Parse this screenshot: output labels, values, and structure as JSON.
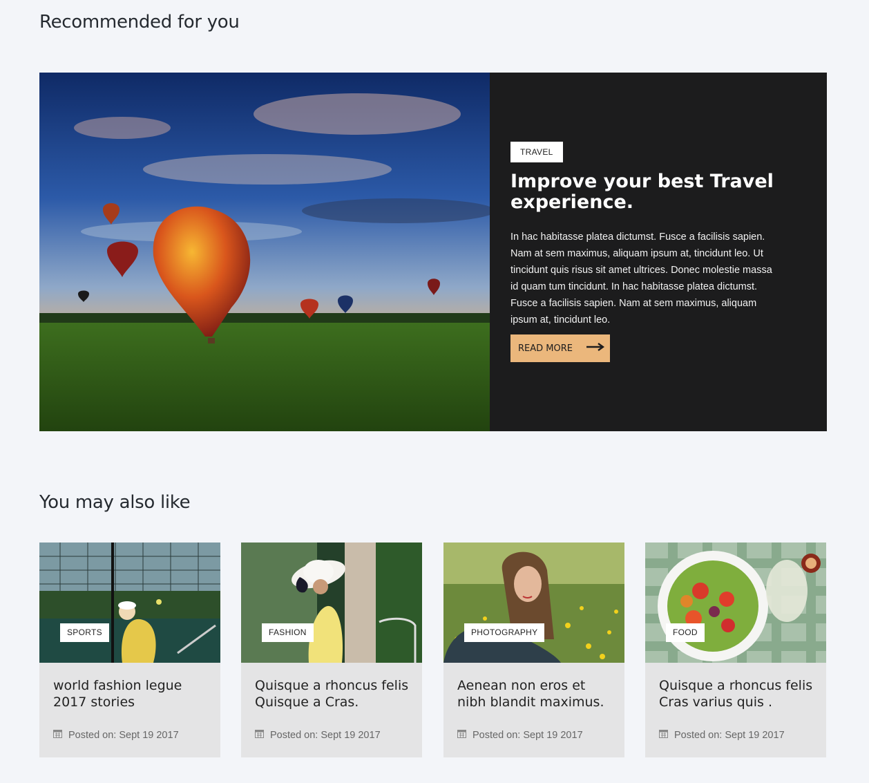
{
  "recommended": {
    "heading": "Recommended for you",
    "featured": {
      "tag": "TRAVEL",
      "title": "Improve your best Travel experience.",
      "body": "In hac habitasse platea dictumst. Fusce a facilisis sapien. Nam at sem maximus, aliquam ipsum at, tincidunt leo. Ut tincidunt quis risus sit amet ultrices. Donec molestie massa id quam tum tincidunt. In hac habitasse platea dictumst. Fusce a facilisis sapien. Nam at sem maximus, aliquam ipsum at, tincidunt leo.",
      "button_label": "READ MORE",
      "button_icon": "arrow-right-icon",
      "image": "hot-air-balloons-photo"
    }
  },
  "also_like": {
    "heading": "You may also like",
    "cards": [
      {
        "tag": "SPORTS",
        "title": "world fashion legue 2017 stories",
        "meta": "Posted on: Sept 19 2017",
        "image": "tennis-player-photo"
      },
      {
        "tag": "FASHION",
        "title": "Quisque a rhoncus felis Quisque a Cras.",
        "meta": "Posted on: Sept 19 2017",
        "image": "woman-in-sunhat-photo"
      },
      {
        "tag": "PHOTOGRAPHY",
        "title": "Aenean non eros et nibh blandit maximus.",
        "meta": "Posted on: Sept 19 2017",
        "image": "woman-in-flowers-photo"
      },
      {
        "tag": "FOOD",
        "title": "Quisque a rhoncus felis Cras varius quis .",
        "meta": "Posted on: Sept 19 2017",
        "image": "salad-bowl-photo"
      }
    ]
  },
  "colors": {
    "page_bg": "#f3f5f9",
    "featured_bg": "#1c1c1d",
    "button_bg": "#ebb77c",
    "card_bg": "#e4e4e5"
  }
}
